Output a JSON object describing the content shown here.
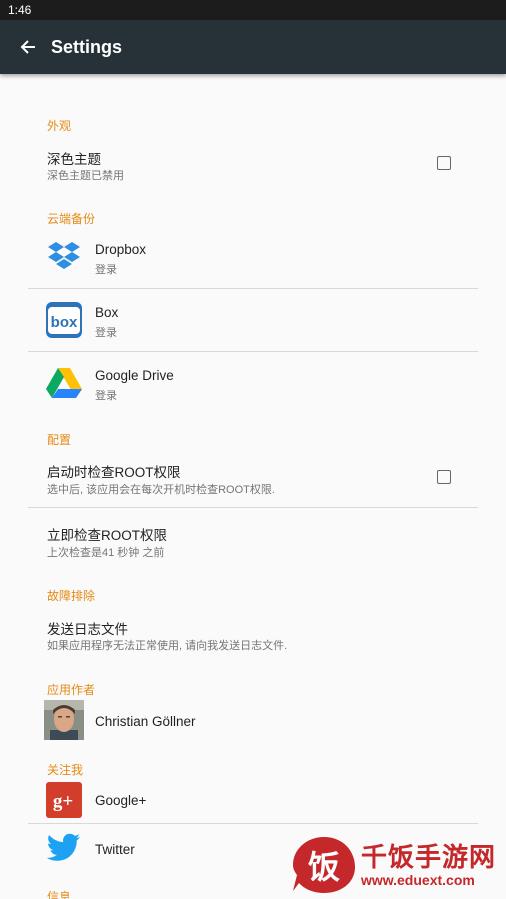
{
  "status_bar": {
    "time": "1:46"
  },
  "app_bar": {
    "title": "Settings",
    "back_icon": "arrow-back-icon"
  },
  "sections": {
    "appearance": "外观",
    "cloud": "云端备份",
    "config": "配置",
    "troubleshoot": "故障排除",
    "author": "应用作者",
    "follow": "关注我",
    "info": "信息"
  },
  "items": {
    "dark_theme": {
      "title": "深色主题",
      "subtitle": "深色主题已禁用",
      "checked": false
    },
    "dropbox": {
      "title": "Dropbox",
      "subtitle": "登录",
      "icon": "dropbox-icon"
    },
    "box": {
      "title": "Box",
      "subtitle": "登录",
      "icon": "box-icon",
      "icon_text": "box"
    },
    "google_drive": {
      "title": "Google Drive",
      "subtitle": "登录",
      "icon": "google-drive-icon"
    },
    "root_on_start": {
      "title": "启动时检查ROOT权限",
      "subtitle": "选中后, 该应用会在每次开机时检查ROOT权限.",
      "checked": false
    },
    "check_root_now": {
      "title": "立即检查ROOT权限",
      "subtitle": "上次检查是41 秒钟 之前"
    },
    "send_logs": {
      "title": "发送日志文件",
      "subtitle": "如果应用程序无法正常使用, 请向我发送日志文件."
    },
    "author": {
      "name": "Christian Göllner"
    },
    "google_plus": {
      "title": "Google+",
      "icon": "google-plus-icon",
      "icon_text": "g+"
    },
    "twitter": {
      "title": "Twitter",
      "icon": "twitter-icon"
    }
  },
  "watermark": {
    "logo_char": "饭",
    "title": "千饭手游网",
    "url": "www.eduext.com"
  },
  "colors": {
    "accent": "#e58a15",
    "app_bar": "#263238",
    "status_bar": "#1c1c1c",
    "background": "#fafafa",
    "watermark": "#c4282a"
  }
}
